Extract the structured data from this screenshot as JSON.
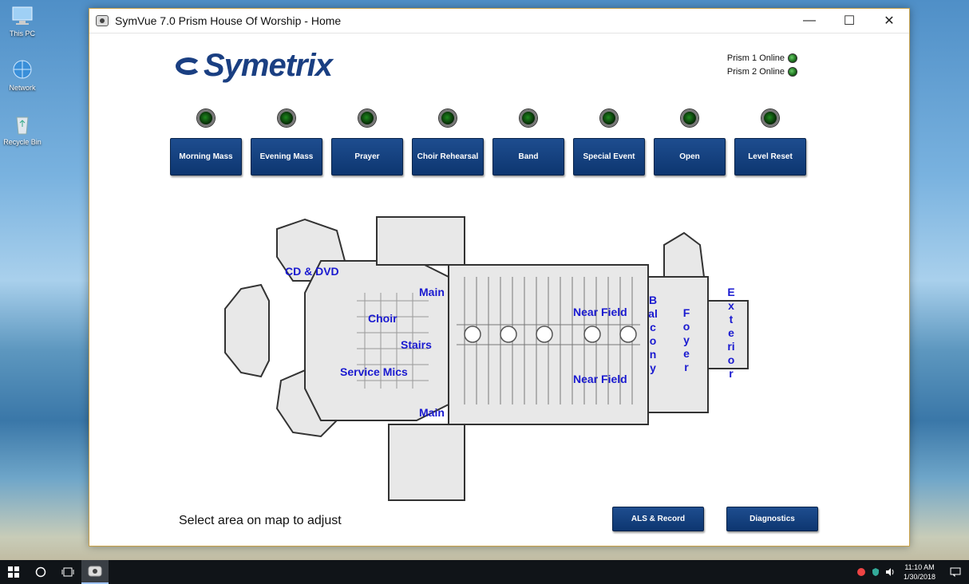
{
  "desktop": {
    "icons": [
      {
        "label": "This PC"
      },
      {
        "label": "Network"
      },
      {
        "label": "Recycle Bin"
      }
    ]
  },
  "window": {
    "title": "SymVue 7.0 Prism House Of Worship - Home",
    "minimize": "—",
    "maximize": "☐",
    "close": "✕"
  },
  "logo": {
    "text": "Symetrix"
  },
  "status": {
    "prism1": "Prism 1 Online",
    "prism2": "Prism 2 Online",
    "led_color": "#1f8a1f"
  },
  "presets": [
    {
      "label": "Morning Mass"
    },
    {
      "label": "Evening Mass"
    },
    {
      "label": "Prayer"
    },
    {
      "label": "Choir Rehearsal"
    },
    {
      "label": "Band"
    },
    {
      "label": "Special Event"
    },
    {
      "label": "Open"
    },
    {
      "label": "Level Reset"
    }
  ],
  "map": {
    "labels": {
      "cd_dvd": "CD & DVD",
      "main_top": "Main",
      "choir": "Choir",
      "stairs": "Stairs",
      "service_mics": "Service Mics",
      "main_bottom": "Main",
      "near_field_top": "Near Field",
      "near_field_bottom": "Near Field",
      "balcony": "Balcony",
      "foyer": "Foyer",
      "exterior": "Exterior"
    },
    "label_color": "#1a1ad0"
  },
  "footer": {
    "hint": "Select area on map to adjust",
    "als_record": "ALS & Record",
    "diagnostics": "Diagnostics"
  },
  "taskbar": {
    "time": "11:10 AM",
    "date": "1/30/2018"
  },
  "colors": {
    "button_blue": "#0d3670",
    "logo_blue": "#1a3f82"
  }
}
